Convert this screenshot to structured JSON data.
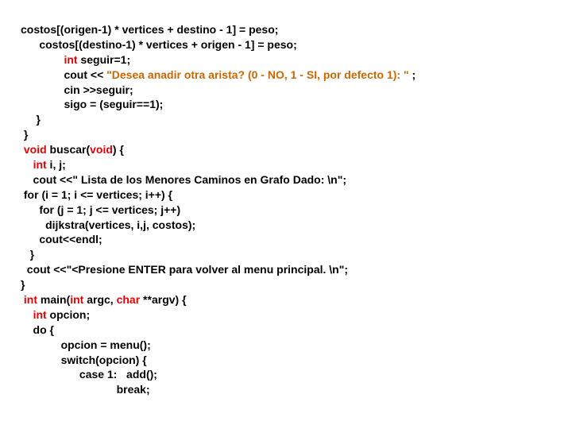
{
  "code": {
    "l1": "costos[(origen-1) * vertices + destino - 1] = peso;",
    "l2": "      costos[(destino-1) * vertices + origen - 1] = peso;",
    "l3a": "              ",
    "l3b": "int",
    "l3c": " seguir=1;",
    "l4a": "              cout << ",
    "l4b": "\"Desea anadir otra arista? (0 - NO, 1 - SI, por defecto 1): \"",
    "l4c": " ;",
    "l5": "              cin >>seguir;",
    "l6": "              sigo = (seguir==1);",
    "l7": "     }",
    "l8": " }",
    "l9a": " ",
    "l9b": "void",
    "l9c": " buscar(",
    "l9d": "void",
    "l9e": ") {",
    "l10a": "    ",
    "l10b": "int",
    "l10c": " i, j;",
    "l11": "    cout <<\" Lista de los Menores Caminos en Grafo Dado: \\n\";",
    "l12": " for (i = 1; i <= vertices; i++) {",
    "l13": "      for (j = 1; j <= vertices; j++)",
    "l14": "        dijkstra(vertices, i,j, costos);",
    "l15": "      cout<<endl;",
    "l16": "   }",
    "l17": "  cout <<\"<Presione ENTER para volver al menu principal. \\n\";",
    "l18": "}",
    "l19a": " ",
    "l19b": "int",
    "l19c": " main(",
    "l19d": "int",
    "l19e": " argc, ",
    "l19f": "char",
    "l19g": " **argv) {",
    "l20a": "    ",
    "l20b": "int",
    "l20c": " opcion;",
    "l21": "    do {",
    "l22": "             opcion = menu();",
    "l23": "             switch(opcion) {",
    "l24": "                   case 1:   add();",
    "l25": "                               break;"
  }
}
